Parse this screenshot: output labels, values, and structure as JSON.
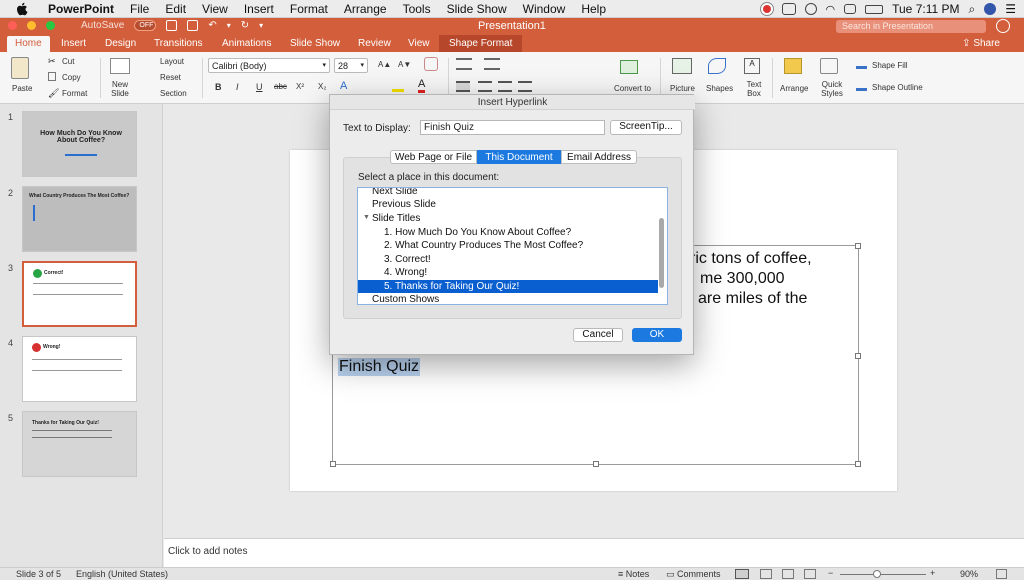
{
  "menubar": {
    "app": "PowerPoint",
    "items": [
      "File",
      "Edit",
      "View",
      "Insert",
      "Format",
      "Arrange",
      "Tools",
      "Slide Show",
      "Window",
      "Help"
    ],
    "clock": "Tue 7:11 PM"
  },
  "titlebar": {
    "autosave": "AutoSave",
    "autosave_state": "OFF",
    "title": "Presentation1",
    "search_placeholder": "Search in Presentation"
  },
  "tabs": {
    "items": [
      "Home",
      "Insert",
      "Design",
      "Transitions",
      "Animations",
      "Slide Show",
      "Review",
      "View",
      "Shape Format"
    ],
    "active": "Home",
    "share": "Share"
  },
  "ribbon": {
    "paste": "Paste",
    "cut": "Cut",
    "copy": "Copy",
    "format": "Format",
    "new_slide": "New Slide",
    "layout": "Layout",
    "reset": "Reset",
    "section": "Section",
    "font_name": "Calibri (Body)",
    "font_size": "28",
    "bold": "B",
    "italic": "I",
    "underline": "U",
    "strike": "abc",
    "superscript": "X²",
    "subscript": "X₂",
    "grow_font": "A▲",
    "shrink_font": "A▼",
    "convert_to": "Convert to",
    "picture": "Picture",
    "shapes": "Shapes",
    "text_box": "Text Box",
    "arrange": "Arrange",
    "quick_styles": "Quick Styles",
    "shape_fill": "Shape Fill",
    "shape_outline": "Shape Outline"
  },
  "thumbnails": [
    {
      "num": "1",
      "title": "How Much Do You Know About Coffee?"
    },
    {
      "num": "2",
      "title": "What Country Produces The Most Coffee?"
    },
    {
      "num": "3",
      "title": "Correct!"
    },
    {
      "num": "4",
      "title": "Wrong!"
    },
    {
      "num": "5",
      "title": "Thanks for Taking Our Quiz!"
    }
  ],
  "slide": {
    "body_line1": "ric tons of coffee,",
    "body_line2": "me 300,000",
    "body_line3": "are miles of the",
    "link_text": "Finish Quiz"
  },
  "notes": {
    "placeholder": "Click to add notes"
  },
  "status": {
    "slide_count": "Slide 3 of 5",
    "language": "English (United States)",
    "notes": "Notes",
    "comments": "Comments",
    "zoom": "90%"
  },
  "dialog": {
    "title": "Insert Hyperlink",
    "text_to_display_label": "Text to Display:",
    "text_to_display_value": "Finish Quiz",
    "screentip": "ScreenTip...",
    "tabs": [
      "Web Page or File",
      "This Document",
      "Email Address"
    ],
    "active_tab": "This Document",
    "select_label": "Select a place in this document:",
    "places": [
      "Next Slide",
      "Previous Slide",
      "Slide Titles",
      "1. How Much Do You Know About Coffee?",
      "2. What Country Produces The Most Coffee?",
      "3. Correct!",
      "4. Wrong!",
      "5. Thanks for Taking Our Quiz!",
      "Custom Shows"
    ],
    "selected_place": "5. Thanks for Taking Our Quiz!",
    "cancel": "Cancel",
    "ok": "OK"
  },
  "colors": {
    "accent": "#d35e3b",
    "selection": "#0a5fd0",
    "ok_button": "#1b79e0"
  }
}
